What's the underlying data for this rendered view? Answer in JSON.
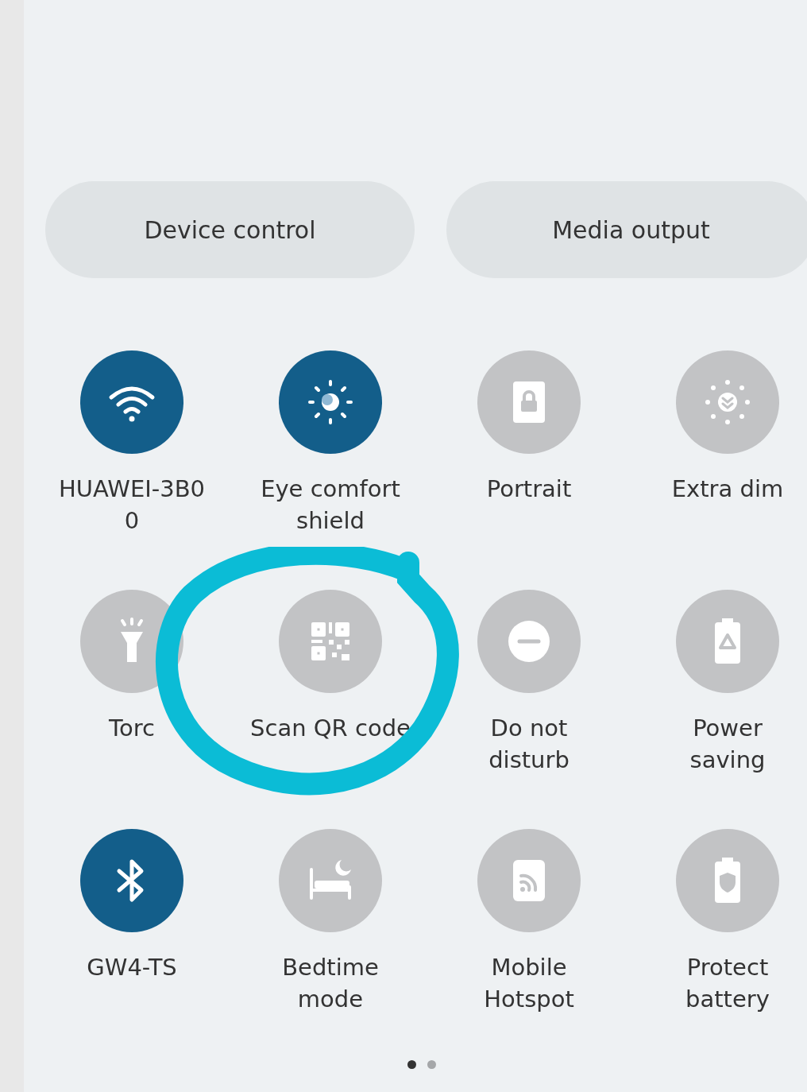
{
  "buttons": [
    {
      "label": "Device control"
    },
    {
      "label": "Media output"
    }
  ],
  "tiles": [
    {
      "label": "HUAWEI-3B0\n0",
      "on": true
    },
    {
      "label": "Eye comfort\nshield",
      "on": true
    },
    {
      "label": "Portrait",
      "on": false
    },
    {
      "label": "Extra dim",
      "on": false
    },
    {
      "label": "Torc",
      "on": false
    },
    {
      "label": "Scan QR code",
      "on": false
    },
    {
      "label": "Do not\ndisturb",
      "on": false
    },
    {
      "label": "Power\nsaving",
      "on": false
    },
    {
      "label": "GW4-TS",
      "on": true
    },
    {
      "label": "Bedtime\nmode",
      "on": false
    },
    {
      "label": "Mobile\nHotspot",
      "on": false
    },
    {
      "label": "Protect\nbattery",
      "on": false
    }
  ],
  "pages": [
    {
      "selected": true
    },
    {
      "selected": false
    }
  ]
}
